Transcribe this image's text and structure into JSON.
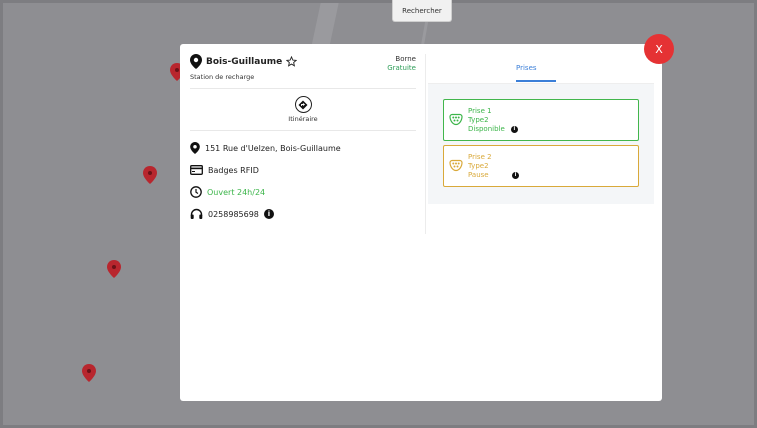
{
  "map": {
    "search_label": "Rechercher"
  },
  "station": {
    "name": "Bois-Guillaume",
    "type_label": "Station de recharge",
    "borne_label": "Borne",
    "price_label": "Gratuite",
    "itinerary_label": "Itinéraire",
    "address": "151 Rue d'Uelzen, Bois-Guillaume",
    "access": "Badges RFID",
    "hours": "Ouvert 24h/24",
    "phone": "0258985698"
  },
  "tabs": [
    {
      "label": "Prises"
    }
  ],
  "prises": [
    {
      "name": "Prise 1",
      "type": "Type2",
      "status": "Disponible",
      "color": "#3cb54a"
    },
    {
      "name": "Prise 2",
      "type": "Type2",
      "status": "Pause",
      "color": "#d9a93a"
    }
  ],
  "close_label": "X",
  "colors": {
    "accent": "#3b7fd8",
    "available": "#3cb54a",
    "paused": "#d9a93a",
    "close": "#e53234",
    "pin": "#b8262e"
  }
}
